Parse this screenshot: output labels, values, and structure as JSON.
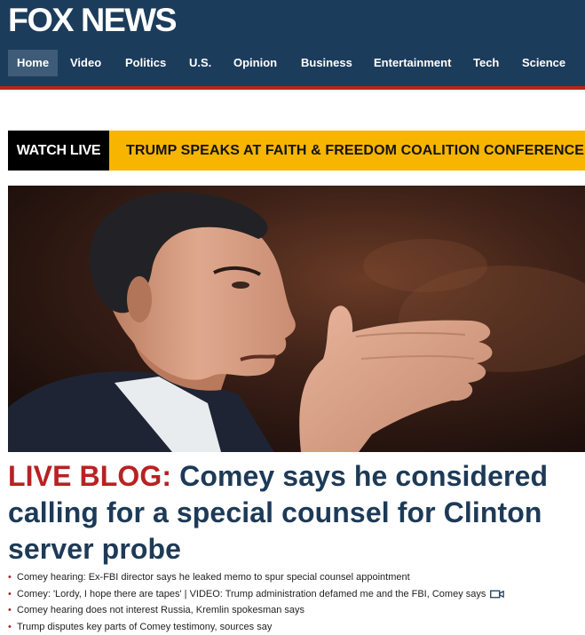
{
  "brand": {
    "logo_text": "FOX NEWS"
  },
  "nav": {
    "items": [
      {
        "label": "Home",
        "active": true
      },
      {
        "label": "Video"
      },
      {
        "label": "Politics"
      },
      {
        "label": "U.S."
      },
      {
        "label": "Opinion"
      },
      {
        "label": "Business"
      },
      {
        "label": "Entertainment"
      },
      {
        "label": "Tech"
      },
      {
        "label": "Science"
      }
    ]
  },
  "live_banner": {
    "tag": "WATCH LIVE",
    "text": "TRUMP SPEAKS AT FAITH & FREEDOM COALITION CONFERENCE"
  },
  "hero": {
    "image_subject": "man-speaking-gesturing-photo"
  },
  "headline": {
    "kicker": "LIVE BLOG:",
    "text": "Comey says he considered calling for a special counsel for Clinton server probe"
  },
  "related": [
    {
      "text": "Comey hearing: Ex-FBI director says he leaked memo to spur special counsel appointment"
    },
    {
      "text": "Comey: 'Lordy, I hope there are tapes' | VIDEO: Trump administration defamed me and the FBI, Comey says",
      "icon": "video-camera-icon"
    },
    {
      "text": "Comey hearing does not interest Russia, Kremlin spokesman says"
    },
    {
      "text": "Trump disputes key parts of Comey testimony, sources say"
    }
  ],
  "colors": {
    "header_bg": "#1c3c5c",
    "accent_red": "#b72222",
    "banner_yellow": "#f7b500",
    "headline_blue": "#1d3a57"
  }
}
